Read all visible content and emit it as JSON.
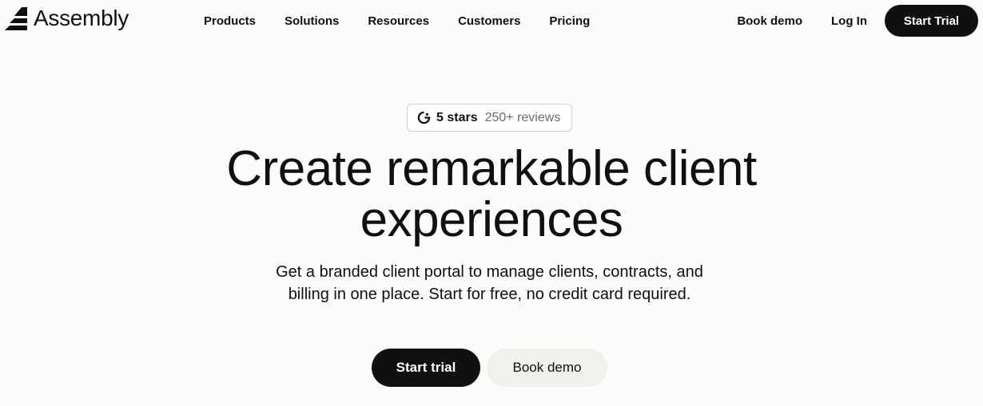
{
  "nav": {
    "logo_text": "Assembly",
    "links": [
      "Products",
      "Solutions",
      "Resources",
      "Customers",
      "Pricing"
    ],
    "book_demo": "Book demo",
    "login": "Log In",
    "start_trial": "Start Trial"
  },
  "badge": {
    "icon": "g2-icon",
    "stars": "5 stars",
    "reviews": "250+ reviews"
  },
  "hero": {
    "title_line1": "Create remarkable client",
    "title_line2": "experiences",
    "subtitle": "Get a branded client portal to manage clients, contracts, and billing in one place. Start for free, no credit card required."
  },
  "cta": {
    "start_trial": "Start trial",
    "book_demo": "Book demo"
  },
  "colors": {
    "background": "#fcfcfa",
    "primary": "#101010",
    "secondary_button": "#f1f0ea"
  }
}
